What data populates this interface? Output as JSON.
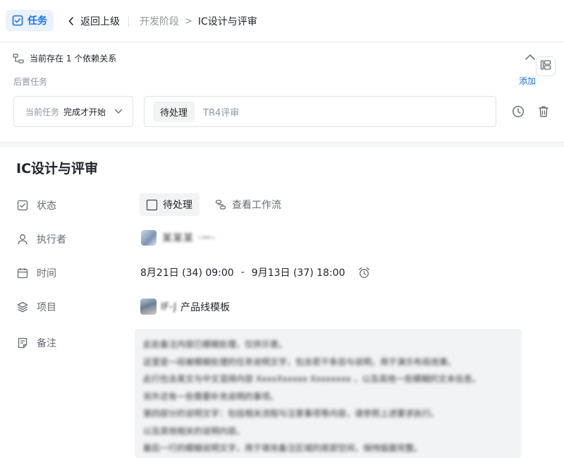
{
  "topbar": {
    "app_tab_label": "任务",
    "back_label": "返回上级",
    "breadcrumb_parent": "开发阶段",
    "breadcrumb_separator": ">",
    "breadcrumb_current": "IC设计与评审"
  },
  "dependency": {
    "header_text": "当前存在 1 个依赖关系",
    "successor_label": "后置任务",
    "add_label": "添加",
    "type_select": {
      "label": "当前任务",
      "value": "完成才开始"
    },
    "linked_task": {
      "status": "待处理",
      "name": "TR4评审"
    }
  },
  "task": {
    "title": "IC设计与评审",
    "fields": {
      "status_label": "状态",
      "assignee_label": "执行者",
      "time_label": "时间",
      "project_label": "项目",
      "notes_label": "备注"
    },
    "status_value": "待处理",
    "workflow_label": "查看工作流",
    "assignee_name": "某某某 ·一·",
    "time_start": "8月21日 (34) 09:00",
    "time_separator": "-",
    "time_end": "9月13日 (37) 18:00",
    "project_prefix": "IF-J",
    "project_name": "产品线模板",
    "notes_lines": [
      "此处备注内容已模糊处理，仅供示意。",
      "这里是一段被模糊处理的任务说明文字，包含若干条目与说明，用于演示布局效果。",
      "此行包含英文与中文混排内容 XxxxXxxxxx Xxxxxxxx ，以及其他一些模糊的文本信息。",
      "另外还有一些需要补充说明的事项。",
      "第四部分的说明文字：包括相关流程与注意事项等内容，请参照上述要求执行。",
      "以及其他相关的说明内容。",
      "最后一行的模糊说明文字，用于填充备注区域的底部空间，保持版面完整。"
    ]
  },
  "colors": {
    "accent": "#1f6fe5",
    "accent_bg": "#eaf2fd",
    "muted_text": "#8f959e",
    "chip_bg": "#f2f3f5",
    "border": "#dfe1e5"
  },
  "icons": {
    "app_tab": "checkbox-square-icon",
    "back": "chevron-left-icon",
    "dependency": "dependency-link-icon",
    "collapse": "chevron-up-icon",
    "side_panel": "side-panel-icon",
    "type_select": "chevron-down-icon",
    "clock": "clock-icon",
    "delete": "trash-icon",
    "status": "checkbox-icon",
    "workflow": "workflow-icon",
    "assignee": "user-icon",
    "time": "calendar-icon",
    "reminder": "alarm-clock-icon",
    "project": "layers-icon",
    "notes": "note-icon"
  }
}
